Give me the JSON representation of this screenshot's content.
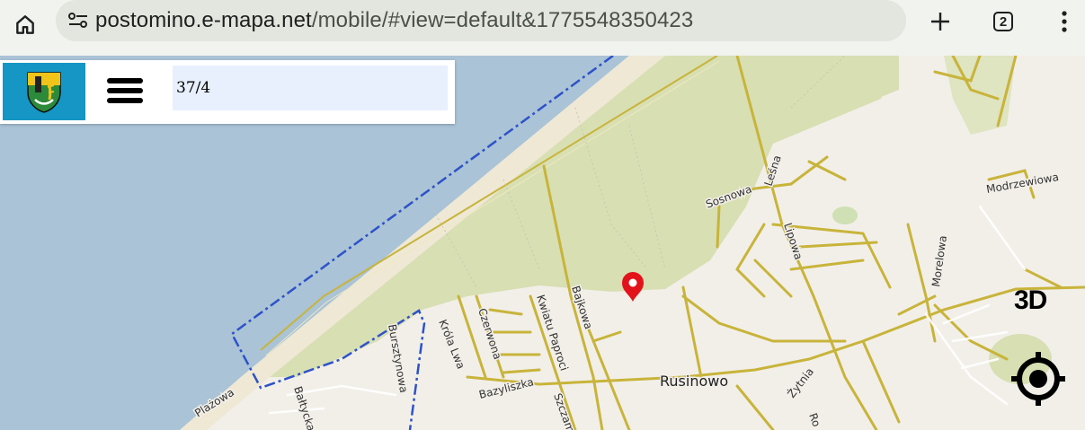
{
  "browser": {
    "url_host": "postomino.e-mapa.net",
    "url_path": "/mobile/#view=default&1775548350423",
    "tab_count": "2",
    "icons": [
      "home-icon",
      "site-settings-icon",
      "plus-icon",
      "tab-switcher-icon",
      "overflow-menu-icon"
    ]
  },
  "map_panel": {
    "search_value": "37/4",
    "icons": [
      "coat-of-arms-icon",
      "hamburger-menu-icon"
    ]
  },
  "controls": {
    "view_3d_label": "3D",
    "locate_icon": "crosshair-locate-icon"
  },
  "map": {
    "place_label": "Rusinowo",
    "streets": [
      "Sosnowa",
      "Leśna",
      "Lipowa",
      "Modrzewiowa",
      "Morelowa",
      "Plażowa",
      "Bałtycka",
      "Bursztynowa",
      "Króla Lwa",
      "Czerwona",
      "Kwiatu Paproci",
      "Bajkowa",
      "Bazyliszka",
      "Szczamek",
      "Żytnia",
      "Ro"
    ],
    "marker_icon": "location-pin-icon",
    "colors": {
      "sea": "#aac3d6",
      "land": "#f2efe9",
      "forest": "#d8dfb3",
      "beach": "#eee8d5",
      "road": "#c8b43a",
      "boundary": "#2d52c9",
      "marker": "#e2131a"
    }
  }
}
